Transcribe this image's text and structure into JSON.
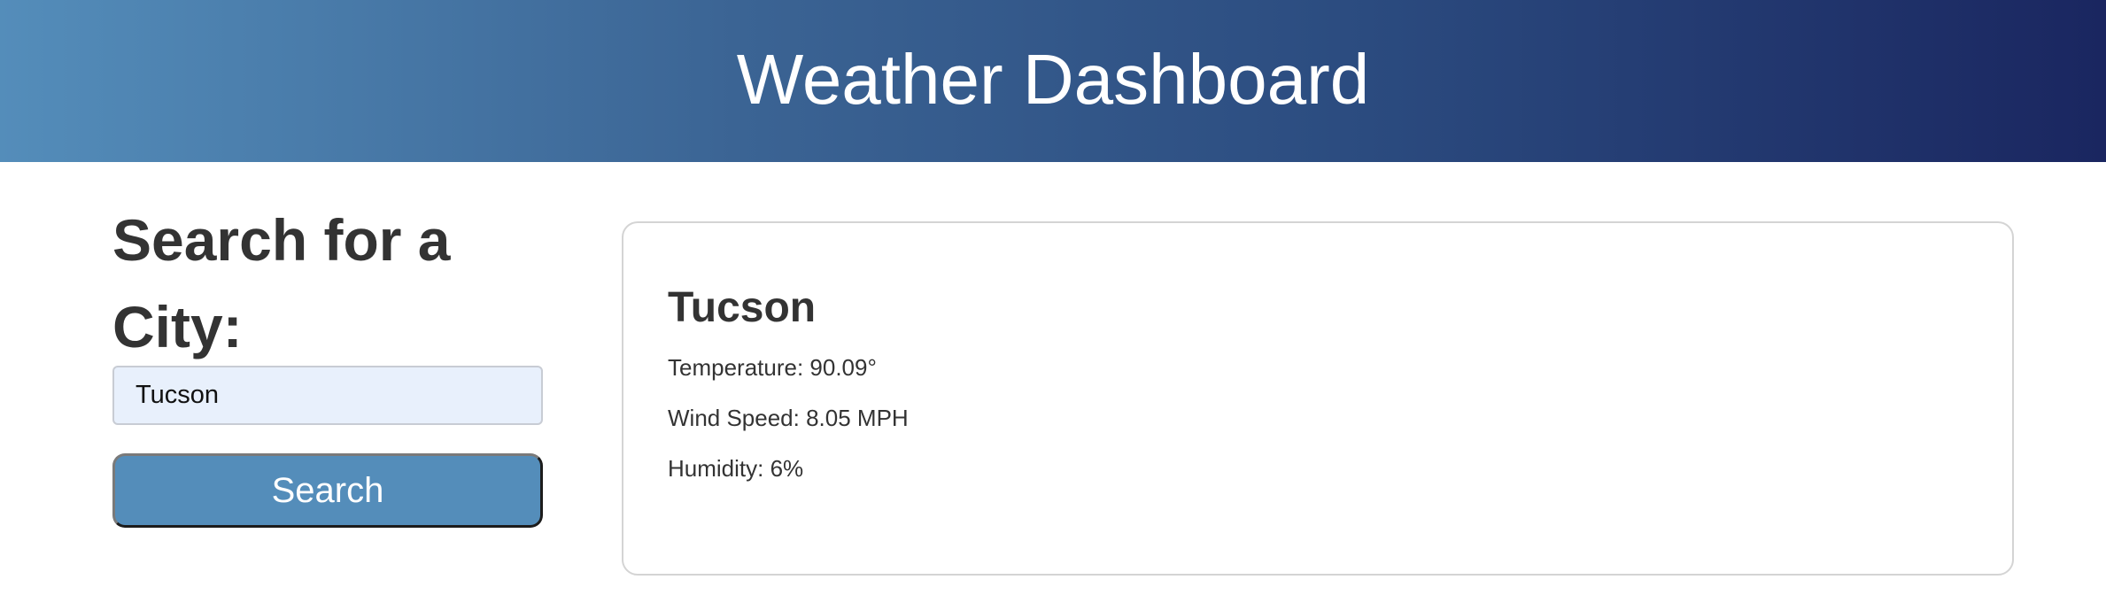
{
  "header": {
    "title": "Weather Dashboard"
  },
  "search": {
    "title": "Search for a City:",
    "input_value": "Tucson",
    "button_label": "Search"
  },
  "weather": {
    "city": "Tucson",
    "temperature": "Temperature: 90.09°",
    "wind_speed": "Wind Speed: 8.05 MPH",
    "humidity": "Humidity: 6%"
  },
  "colors": {
    "header_gradient_start": "#548dba",
    "header_gradient_end": "#1a2660",
    "button_background": "#548dba",
    "input_background": "#e8f0fc"
  }
}
